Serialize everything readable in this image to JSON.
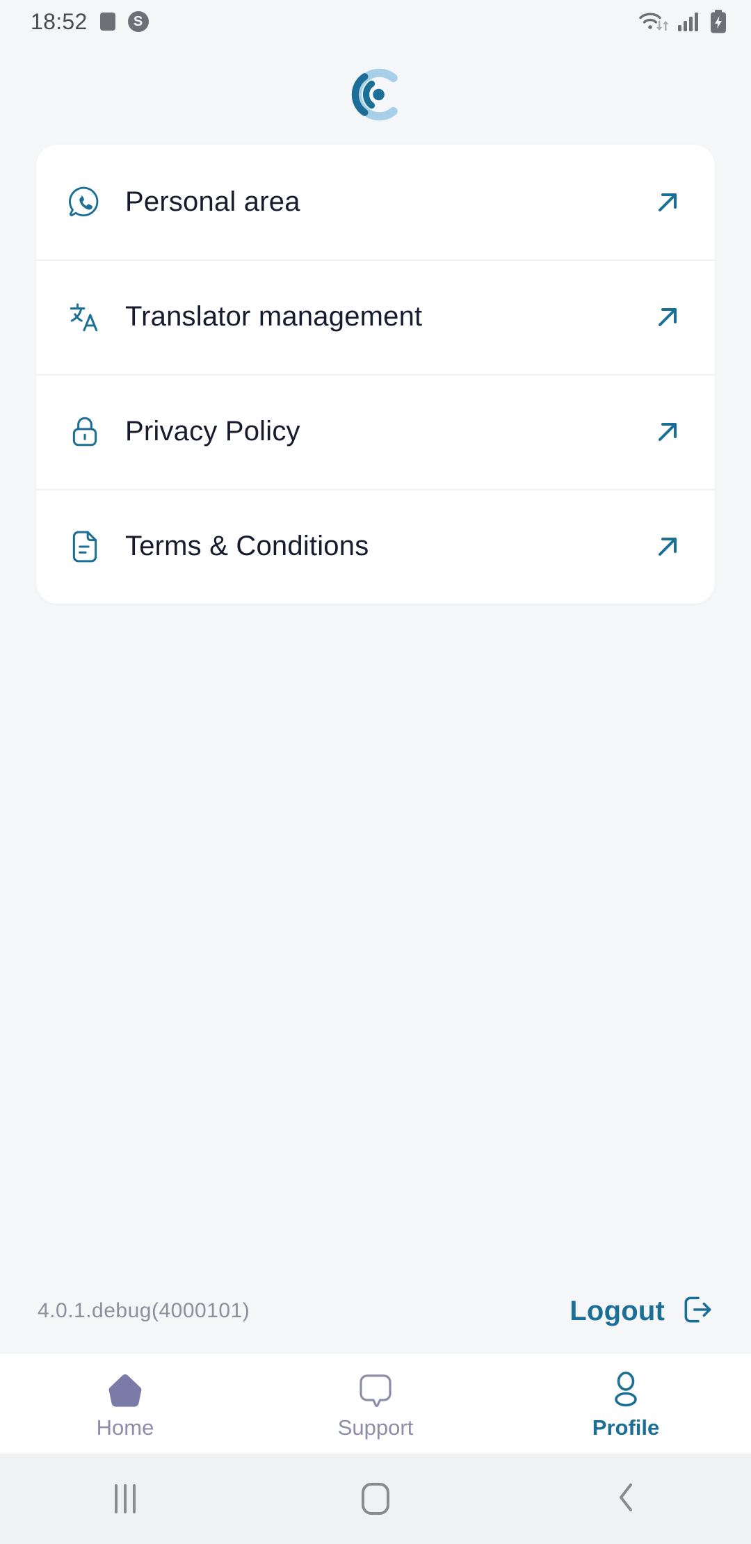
{
  "status_bar": {
    "time": "18:52",
    "left_icons": [
      {
        "name": "screen-record-indicator",
        "glyph": "square"
      },
      {
        "name": "skype-notification-icon",
        "glyph": "S"
      }
    ],
    "right_icons": [
      {
        "name": "wifi-icon"
      },
      {
        "name": "cellular-signal-icon"
      },
      {
        "name": "battery-charging-icon"
      }
    ]
  },
  "brand": {
    "logo_name": "app-logo-c-mark",
    "logo_color_dark": "#1b6e95",
    "logo_color_light": "#a8cfe8"
  },
  "colors": {
    "background": "#f5f6f8",
    "card": "#ffffff",
    "accent": "#1b6e95",
    "text_primary": "#161b2e",
    "text_muted": "#8b8f9c",
    "nav_inactive": "#8c8cab",
    "home_icon": "#7b7ba8"
  },
  "menu": {
    "items": [
      {
        "label": "Personal area",
        "icon": "whatsapp-phone-bubble-icon",
        "arrow": "arrow-up-right-icon"
      },
      {
        "label": "Translator management",
        "icon": "translate-icon",
        "arrow": "arrow-up-right-icon"
      },
      {
        "label": "Privacy Policy",
        "icon": "lock-icon",
        "arrow": "arrow-up-right-icon"
      },
      {
        "label": "Terms & Conditions",
        "icon": "document-text-icon",
        "arrow": "arrow-up-right-icon"
      }
    ]
  },
  "footer": {
    "version": "4.0.1.debug(4000101)",
    "logout_label": "Logout",
    "logout_icon": "logout-icon"
  },
  "bottom_nav": {
    "tabs": [
      {
        "label": "Home",
        "icon": "home-pentagon-icon",
        "active": false
      },
      {
        "label": "Support",
        "icon": "chat-bubble-icon",
        "active": false
      },
      {
        "label": "Profile",
        "icon": "person-icon",
        "active": true
      }
    ]
  },
  "android_nav": {
    "buttons": [
      {
        "name": "recents-button"
      },
      {
        "name": "home-button"
      },
      {
        "name": "back-button"
      }
    ]
  }
}
